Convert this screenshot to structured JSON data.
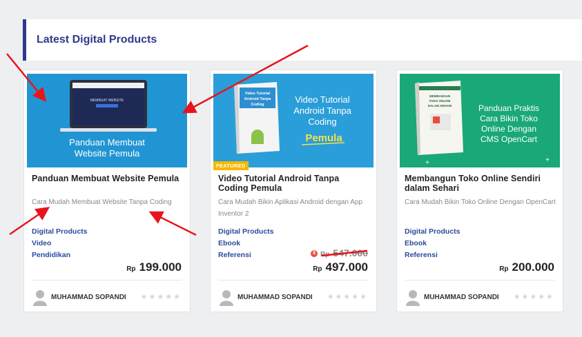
{
  "section": {
    "title": "Latest Digital Products"
  },
  "products": [
    {
      "title": "Panduan Membuat Website Pemula",
      "description": "Cara Mudah Membuat Website Tanpa Coding",
      "categories": [
        "Digital Products",
        "Video",
        "Pendidikan"
      ],
      "currency": "Rp",
      "price": "199.000",
      "author": "MUHAMMAD SOPANDI",
      "rating_stars": "★★★★★",
      "thumbnail": {
        "line1": "Panduan Membuat",
        "line2": "Website Pemula",
        "bg": "#1c8fcf"
      }
    },
    {
      "title": "Video Tutorial Android Tanpa Coding Pemula",
      "description": "Cara Mudah Bikin Aplikasi Android dengan App Inventor 2",
      "categories": [
        "Digital Products",
        "Ebook",
        "Referensi"
      ],
      "currency": "Rp",
      "old_price": "547.000",
      "price": "497.000",
      "badge": "FEATURED",
      "sale_icon": "$",
      "author": "MUHAMMAD SOPANDI",
      "rating_stars": "★★★★★",
      "thumbnail": {
        "line1": "Video Tutorial",
        "line2": "Android Tanpa",
        "line3": "Coding",
        "line4": "Pemula",
        "box_text": "Video Tutorial Android Tanpa Coding",
        "bg": "#2a9ed8"
      }
    },
    {
      "title": "Membangun Toko Online Sendiri dalam Sehari",
      "description": "Cara Mudah Bikin Toko Online Dengan OpenCart",
      "categories": [
        "Digital Products",
        "Ebook",
        "Referensi"
      ],
      "currency": "Rp",
      "price": "200.000",
      "author": "MUHAMMAD SOPANDI",
      "rating_stars": "★★★★★",
      "thumbnail": {
        "line1": "Panduan Praktis",
        "line2": "Cara Bikin Toko",
        "line3": "Online Dengan",
        "line4": "CMS OpenCart",
        "box_text": "MEMBANGUN TOKO ONLINE SENDIRI DALAM SEHARI",
        "bg": "#1aa878"
      }
    }
  ],
  "colors": {
    "accent": "#2d3a8c",
    "link": "#2d4a9c",
    "annotation": "#e8141c",
    "featured": "#f5b800"
  }
}
